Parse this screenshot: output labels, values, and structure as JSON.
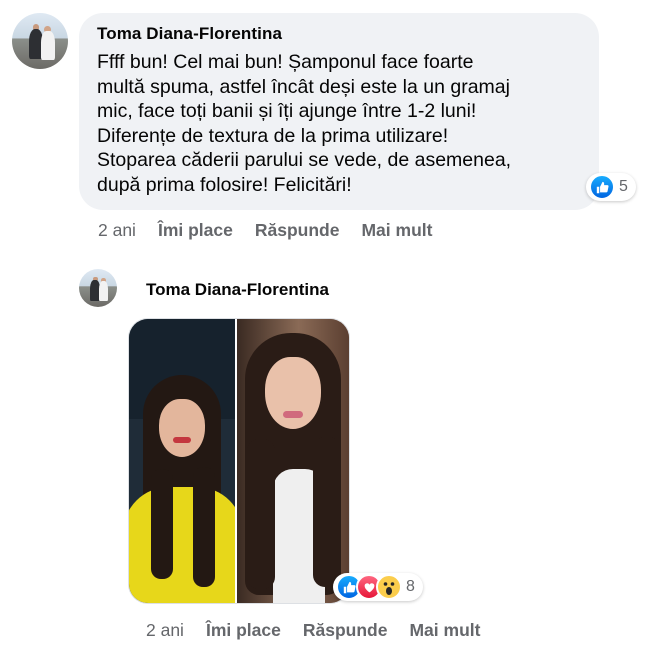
{
  "comment1": {
    "author": "Toma Diana-Florentina",
    "text": "Ffff bun! Cel mai bun! Șamponul face foarte\nmultă spuma, astfel încât deși este la un gramaj\nmic, face toți banii și îți ajunge între 1-2 luni!\nDiferențe de textura de la prima utilizare!\nStoparea căderii parului se vede, de asemenea,\ndupă prima folosire! Felicitări!",
    "reactions": {
      "icons": [
        "like-icon"
      ],
      "count": "5"
    },
    "actions": {
      "time": "2 ani",
      "like": "Îmi place",
      "reply": "Răspunde",
      "more": "Mai mult"
    }
  },
  "comment2": {
    "author": "Toma Diana-Florentina",
    "reactions": {
      "icons": [
        "like-icon",
        "love-icon",
        "wow-icon"
      ],
      "count": "8"
    },
    "actions": {
      "time": "2 ani",
      "like": "Îmi place",
      "reply": "Răspunde",
      "more": "Mai mult"
    }
  },
  "colors": {
    "bubble_bg": "#f0f2f5",
    "secondary_text": "#65676b",
    "like_blue": "#0866ff",
    "love_red": "#f33e58",
    "wow_yellow": "#fbcd4c"
  }
}
